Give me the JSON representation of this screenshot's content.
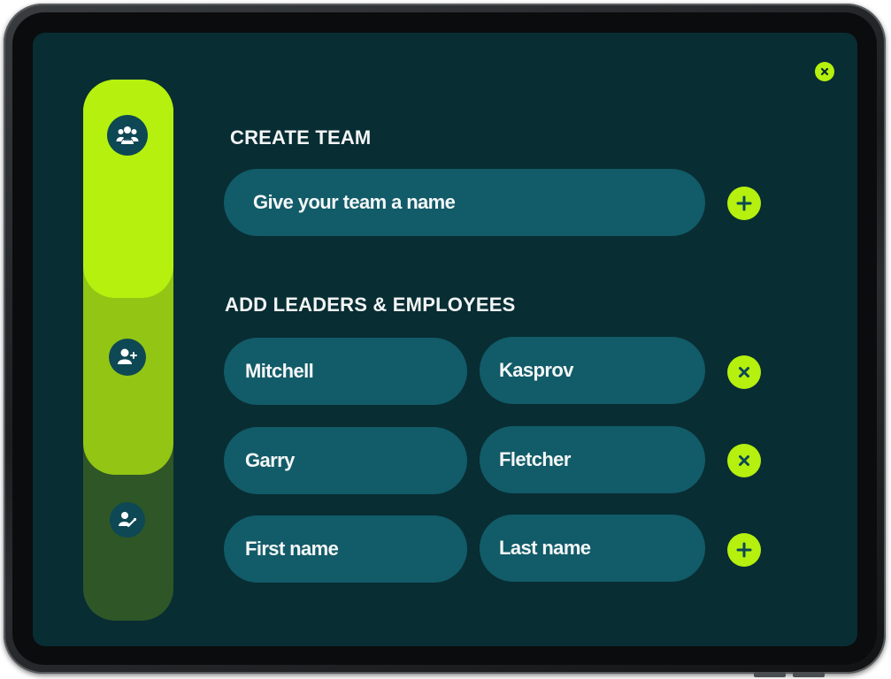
{
  "create_team": {
    "heading": "CREATE TEAM",
    "team_name_placeholder": "Give your team a name"
  },
  "members": {
    "heading": "ADD LEADERS & EMPLOYEES",
    "rows": [
      {
        "first": "Mitchell",
        "last": "Kasprov"
      },
      {
        "first": "Garry",
        "last": "Fletcher"
      }
    ],
    "new_row": {
      "first_placeholder": "First name",
      "last_placeholder": "Last name"
    }
  },
  "icons": {
    "close": "close-icon",
    "add": "plus-icon",
    "remove": "close-icon",
    "step1": "team-icon",
    "step2": "add-user-icon",
    "step3": "assign-user-icon"
  },
  "colors": {
    "screen_bg": "#082d33",
    "accent": "#b5f00f",
    "field_bg": "#125b68",
    "step2_bg": "#93c514",
    "step3_bg": "#2e5627"
  }
}
